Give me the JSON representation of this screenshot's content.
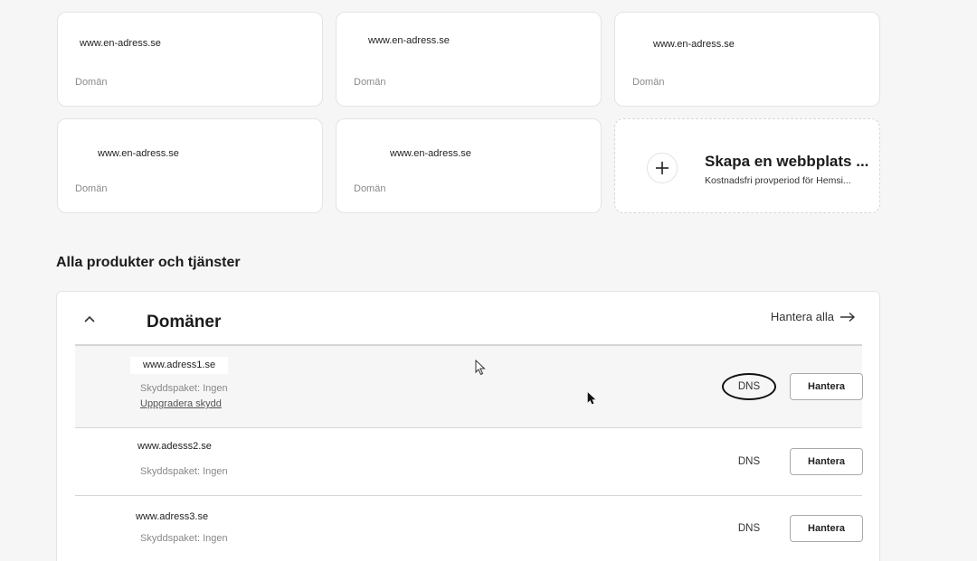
{
  "cards": [
    {
      "url": "www.en-adress.se",
      "type": "Domän"
    },
    {
      "url": "www.en-adress.se",
      "type": "Domän"
    },
    {
      "url": "www.en-adress.se",
      "type": "Domän"
    },
    {
      "url": "www.en-adress.se",
      "type": "Domän"
    },
    {
      "url": "www.en-adress.se",
      "type": "Domän"
    }
  ],
  "create_card": {
    "title": "Skapa en webbplats ...",
    "subtitle": "Kostnadsfri provperiod för Hemsi..."
  },
  "section": {
    "title": "Alla produkter och tjänster"
  },
  "domains_panel": {
    "title": "Domäner",
    "manage_all": "Hantera alla",
    "rows": [
      {
        "domain": "www.adress1.se",
        "protection": "Skyddspaket: Ingen",
        "upgrade": "Uppgradera skydd",
        "dns": "DNS",
        "manage": "Hantera"
      },
      {
        "domain": "www.adesss2.se",
        "protection": "Skyddspaket: Ingen",
        "dns": "DNS",
        "manage": "Hantera"
      },
      {
        "domain": "www.adress3.se",
        "protection": "Skyddspaket: Ingen",
        "dns": "DNS",
        "manage": "Hantera"
      }
    ]
  },
  "colors": {
    "background": "#f5f6f5",
    "card": "#ffffff",
    "text": "#1b1b1b",
    "muted": "#8a8a8a"
  }
}
